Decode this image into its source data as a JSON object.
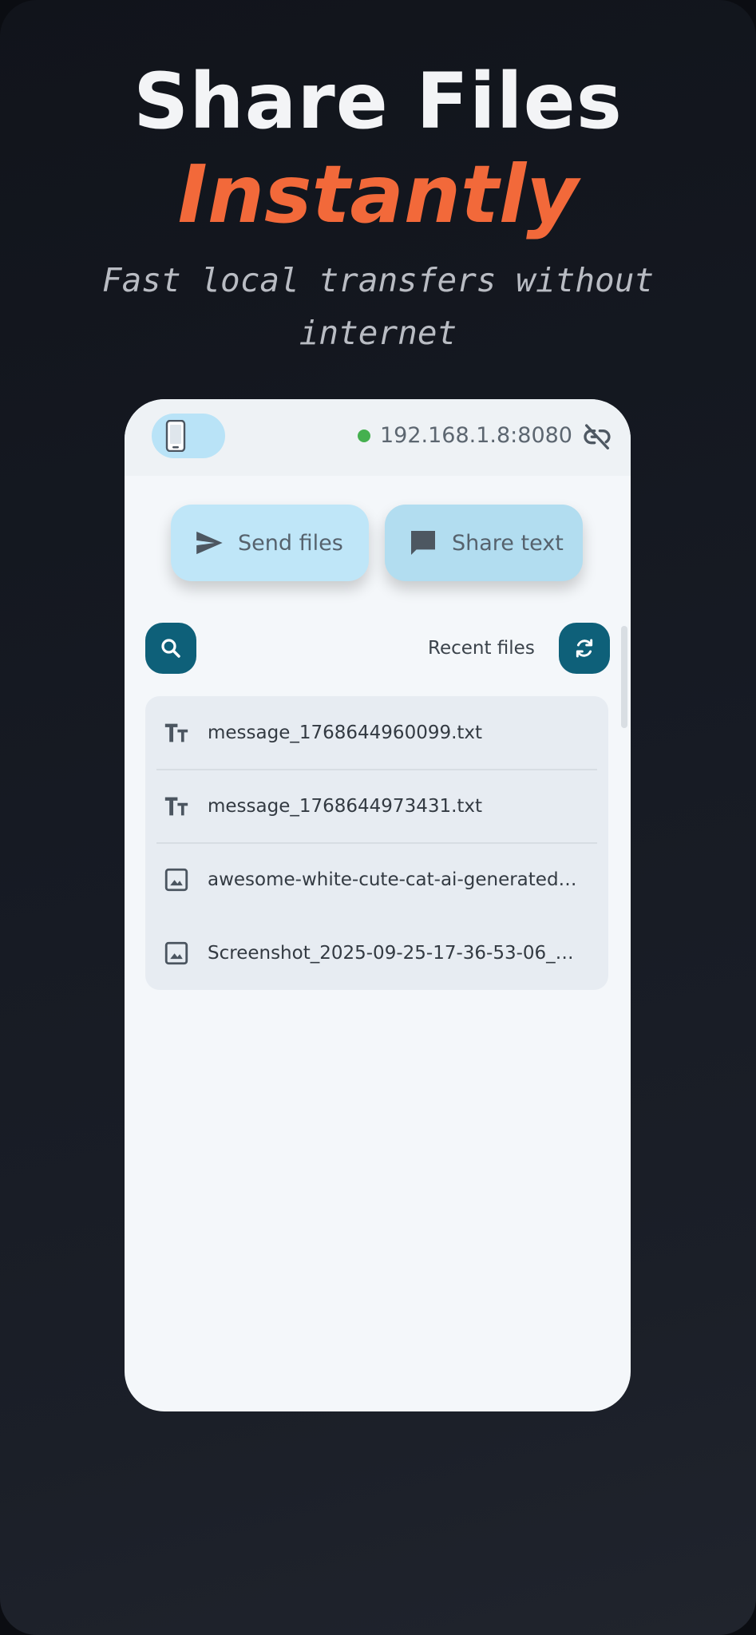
{
  "headline": {
    "title": "Share Files",
    "accent": "Instantly",
    "tagline": "Fast local transfers without internet"
  },
  "app": {
    "status": {
      "device_icon": "phone-icon",
      "address": "192.168.1.8:8080",
      "connected_color": "#45b04f",
      "unlink_icon": "link-off-icon"
    },
    "actions": {
      "send_label": "Send files",
      "share_label": "Share text"
    },
    "recent": {
      "label": "Recent files",
      "files": [
        {
          "name": "message_1768644960099.txt",
          "icon": "text-icon"
        },
        {
          "name": "message_1768644973431.txt",
          "icon": "text-icon"
        },
        {
          "name": "awesome-white-cute-cat-ai-generated_...",
          "icon": "image-icon"
        },
        {
          "name": "Screenshot_2025-09-25-17-36-53-06_2...",
          "icon": "image-icon"
        }
      ]
    }
  },
  "colors": {
    "accent": "#f2693a",
    "primary": "#0e6079",
    "button": "#bfe6f8"
  }
}
